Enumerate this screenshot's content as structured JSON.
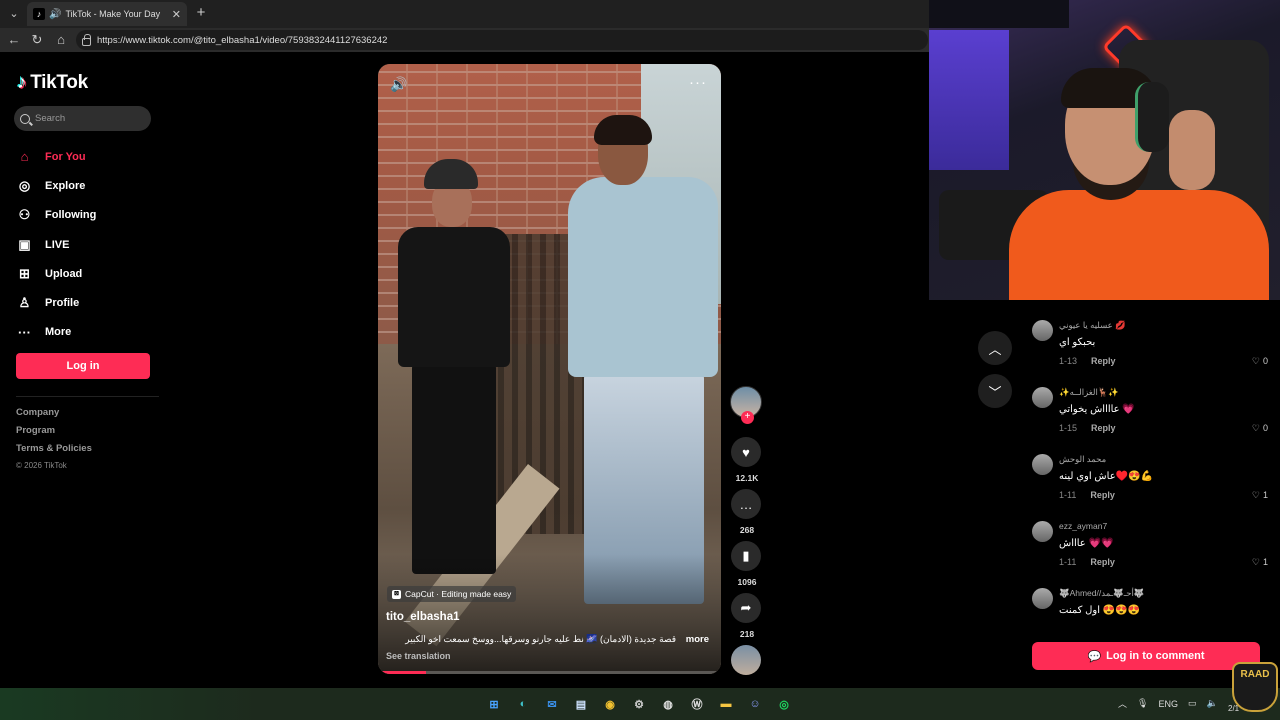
{
  "browser": {
    "tab_title": "TikTok - Make Your Day",
    "url": "https://www.tiktok.com/@tito_elbasha1/video/7593832441127636242"
  },
  "sidebar": {
    "logo": "TikTok",
    "search_placeholder": "Search",
    "nav": [
      {
        "label": "For You",
        "icon": "home-icon"
      },
      {
        "label": "Explore",
        "icon": "compass-icon"
      },
      {
        "label": "Following",
        "icon": "user-follow-icon"
      },
      {
        "label": "LIVE",
        "icon": "live-icon"
      },
      {
        "label": "Upload",
        "icon": "upload-icon"
      },
      {
        "label": "Profile",
        "icon": "profile-icon"
      },
      {
        "label": "More",
        "icon": "more-icon"
      }
    ],
    "login_label": "Log in",
    "footer": [
      "Company",
      "Program",
      "Terms & Policies"
    ],
    "copyright": "© 2026 TikTok"
  },
  "video": {
    "capcut_label": "CapCut · Editing made easy",
    "author": "tito_elbasha1",
    "caption": "قصة جديدة (الادمان) 🌌 نط عليه جارنو وسرقها...ووسخ سمعت اخو الكبير",
    "more_label": "more",
    "translation_label": "See translation",
    "progress": 0.14
  },
  "actions": {
    "likes": "12.1K",
    "comments": "268",
    "saves": "1096",
    "shares": "218"
  },
  "comments": [
    {
      "user": "عسليه يا عيوني 💋",
      "text": "بحبكو اي",
      "time": "1-13",
      "likes": "0"
    },
    {
      "user": "✨الغزالــه🦌✨",
      "text": "عااااش يخواتي 💗",
      "time": "1-15",
      "likes": "0"
    },
    {
      "user": "محمد الوحش",
      "text": "عاش اوي لينه♥️😍💪",
      "time": "1-11",
      "likes": "1"
    },
    {
      "user": "ezz_ayman7",
      "text": "عاااش 💗💗",
      "time": "1-11",
      "likes": "1"
    },
    {
      "user": "🐺Ahmed//أحـ🐺ـمد🐺",
      "text": "اول كمنت 😍😍😍",
      "time": "",
      "likes": ""
    }
  ],
  "reply_label": "Reply",
  "login_comment_label": "Log in to comment",
  "badge_text": "RAAD",
  "tray": {
    "lang": "ENG",
    "time": "2/1"
  },
  "colors": {
    "brand": "#fe2c55",
    "background": "#000000"
  }
}
